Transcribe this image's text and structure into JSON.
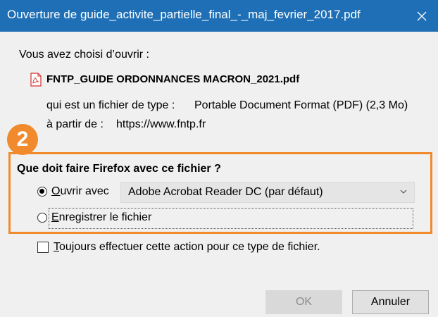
{
  "dialog": {
    "title": "Ouverture de guide_activite_partielle_final_-_maj_fevrier_2017.pdf",
    "intro": "Vous avez choisi d’ouvrir :",
    "file_name": "FNTP_GUIDE ORDONNANCES MACRON_2021.pdf",
    "type_label": "qui est un fichier de type :",
    "type_value": "Portable Document Format (PDF) (2,3 Mo)",
    "source_label": "à partir de :",
    "source_value": "https://www.fntp.fr"
  },
  "annotation": {
    "badge_number": "2",
    "accent_color": "#f08a2c"
  },
  "question": "Que doit faire Firefox avec ce fichier ?",
  "options": {
    "open_with": {
      "accel": "O",
      "rest": "uvrir avec",
      "selected": true
    },
    "app_select": "Adobe Acrobat Reader DC (par défaut)",
    "save": {
      "accel": "E",
      "rest": "nregistrer le fichier",
      "selected": false
    }
  },
  "always": {
    "accel": "T",
    "rest": "oujours effectuer cette action pour ce type de fichier.",
    "checked": false
  },
  "buttons": {
    "ok": "OK",
    "cancel": "Annuler"
  },
  "colors": {
    "titlebar": "#1e6fb5",
    "dialog_bg": "#f0f0f0"
  },
  "icons": {
    "file": "pdf-icon",
    "close": "close-icon",
    "dropdown": "chevron-down-icon"
  }
}
